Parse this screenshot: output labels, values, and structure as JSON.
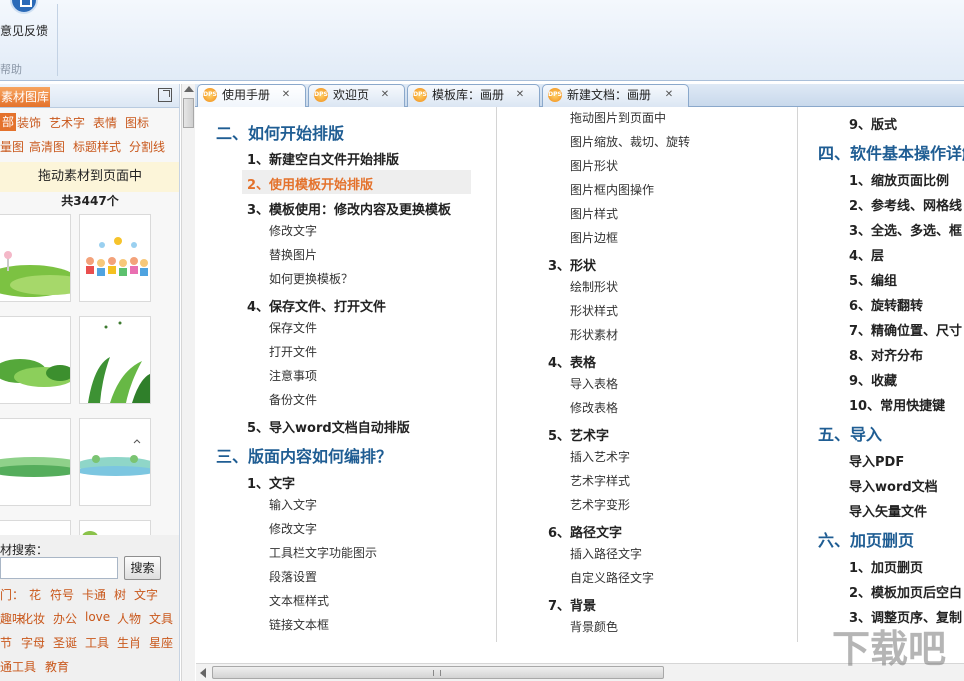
{
  "ribbon": {
    "feedback_label": "意见反馈",
    "group_label": "帮助"
  },
  "left_panel": {
    "tab_label": "素材图库",
    "category_row1": [
      "部",
      "装饰",
      "艺术字",
      "表情",
      "图标"
    ],
    "category_row2": [
      "量图",
      "高清图",
      "标题样式",
      "分割线"
    ],
    "drag_hint": "拖动素材到页面中",
    "count_text": "共3447个",
    "search_label": "材搜索：",
    "search_value": "",
    "search_button": "搜索",
    "hot_rows": [
      [
        "门：",
        "花",
        "符号",
        "卡通",
        "树",
        "文字"
      ],
      [
        "趣味",
        "化妆",
        "办公",
        "love",
        "人物",
        "文具"
      ],
      [
        "节",
        "字母",
        "圣诞",
        "工具",
        "生肖",
        "星座"
      ],
      [
        "通工具",
        "教育"
      ]
    ]
  },
  "tabs": [
    {
      "label": "使用手册",
      "icon": "dps-icon",
      "active": true
    },
    {
      "label": "欢迎页",
      "icon": "dps-icon",
      "active": false
    },
    {
      "label": "模板库：画册",
      "icon": "dps-icon",
      "active": false
    },
    {
      "label": "新建文档：画册",
      "icon": "dps-icon",
      "active": false
    }
  ],
  "manual": {
    "col1": {
      "section2": "二、如何开始排版",
      "s2_1": "1、新建空白文件开始排版",
      "s2_2": "2、使用模板开始排版",
      "s2_3": "3、模板使用：修改内容及更换模板",
      "s2_3a": "修改文字",
      "s2_3b": "替换图片",
      "s2_3c": "如何更换模板？",
      "s2_4": "4、保存文件、打开文件",
      "s2_4a": "保存文件",
      "s2_4b": "打开文件",
      "s2_4c": "注意事项",
      "s2_4d": "备份文件",
      "s2_5": "5、导入word文档自动排版",
      "section3": "三、版面内容如何编排？",
      "s3_1": "1、文字",
      "s3_1a": "输入文字",
      "s3_1b": "修改文字",
      "s3_1c": "工具栏文字功能图示",
      "s3_1d": "段落设置",
      "s3_1e": "文本框样式",
      "s3_1f": "链接文本框"
    },
    "col2": {
      "s2a": "拖动图片到页面中",
      "s2b": "图片缩放、裁切、旋转",
      "s2c": "图片形状",
      "s2d": "图片框内图操作",
      "s2e": "图片样式",
      "s2f": "图片边框",
      "s3": "3、形状",
      "s3a": "绘制形状",
      "s3b": "形状样式",
      "s3c": "形状素材",
      "s4": "4、表格",
      "s4a": "导入表格",
      "s4b": "修改表格",
      "s5": "5、艺术字",
      "s5a": "插入艺术字",
      "s5b": "艺术字样式",
      "s5c": "艺术字变形",
      "s6": "6、路径文字",
      "s6a": "插入路径文字",
      "s6b": "自定义路径文字",
      "s7": "7、背景",
      "s7a": "背景颜色"
    },
    "col3": {
      "s9": "9、版式",
      "section4": "四、软件基本操作详解",
      "s4_1": "1、缩放页面比例",
      "s4_2": "2、参考线、网格线",
      "s4_3": "3、全选、多选、框",
      "s4_4": "4、层",
      "s4_5": "5、编组",
      "s4_6": "6、旋转翻转",
      "s4_7": "7、精确位置、尺寸",
      "s4_8": "8、对齐分布",
      "s4_9": "9、收藏",
      "s4_10": "10、常用快捷键",
      "section5": "五、导入",
      "s5_1": "导入PDF",
      "s5_2": "导入word文档",
      "s5_3": "导入矢量文件",
      "section6": "六、加页删页",
      "s6_1": "1、加页删页",
      "s6_2": "2、模板加页后空白",
      "s6_3": "3、调整页序、复制"
    }
  },
  "watermark_text": "下载吧",
  "colors": {
    "accent_orange": "#e4722c",
    "heading_blue": "#1f5d93",
    "tab_blue": "#c9d9ec"
  }
}
